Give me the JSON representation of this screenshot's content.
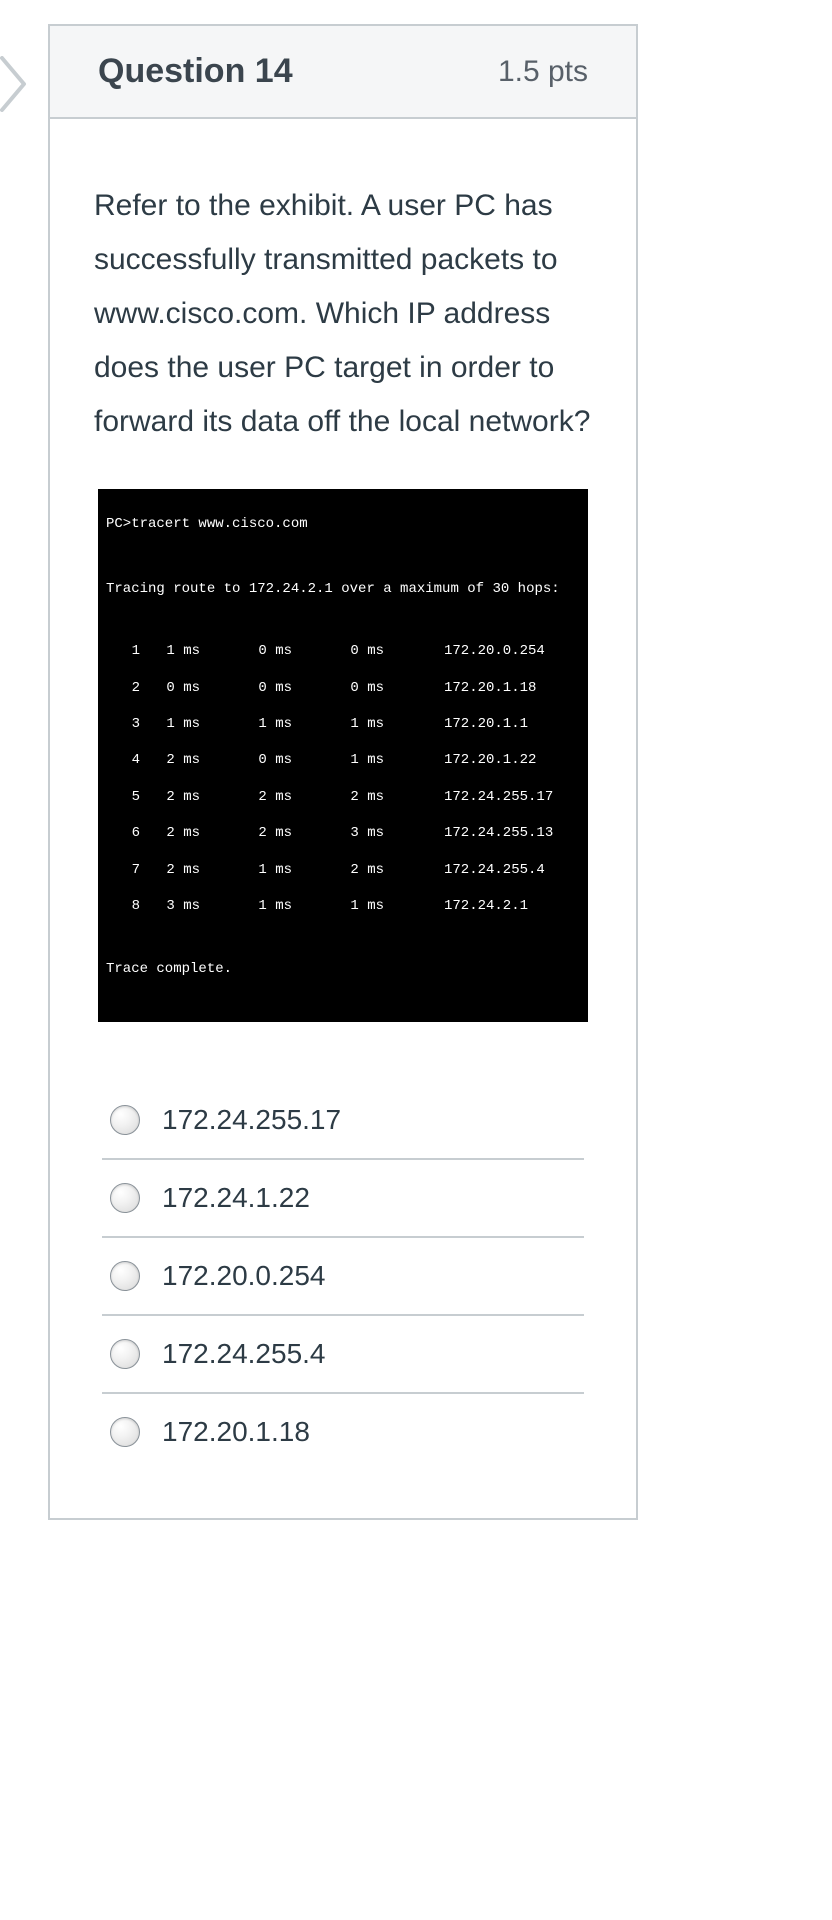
{
  "header": {
    "title": "Question 14",
    "points": "1.5 pts"
  },
  "question": "Refer to the exhibit. A user PC has successfully transmitted packets to www.cisco.com. Which IP address does the user PC target in order to forward its data off the local network?",
  "terminal": {
    "command": "PC>tracert www.cisco.com",
    "trace_header": "Tracing route to 172.24.2.1 over a maximum of 30 hops:",
    "hops": [
      {
        "n": "1",
        "t1": "1 ms",
        "t2": "0 ms",
        "t3": "0 ms",
        "ip": "172.20.0.254"
      },
      {
        "n": "2",
        "t1": "0 ms",
        "t2": "0 ms",
        "t3": "0 ms",
        "ip": "172.20.1.18"
      },
      {
        "n": "3",
        "t1": "1 ms",
        "t2": "1 ms",
        "t3": "1 ms",
        "ip": "172.20.1.1"
      },
      {
        "n": "4",
        "t1": "2 ms",
        "t2": "0 ms",
        "t3": "1 ms",
        "ip": "172.20.1.22"
      },
      {
        "n": "5",
        "t1": "2 ms",
        "t2": "2 ms",
        "t3": "2 ms",
        "ip": "172.24.255.17"
      },
      {
        "n": "6",
        "t1": "2 ms",
        "t2": "2 ms",
        "t3": "3 ms",
        "ip": "172.24.255.13"
      },
      {
        "n": "7",
        "t1": "2 ms",
        "t2": "1 ms",
        "t3": "2 ms",
        "ip": "172.24.255.4"
      },
      {
        "n": "8",
        "t1": "3 ms",
        "t2": "1 ms",
        "t3": "1 ms",
        "ip": "172.24.2.1"
      }
    ],
    "complete": "Trace complete."
  },
  "options": [
    "172.24.255.17",
    "172.24.1.22",
    "172.20.0.254",
    "172.24.255.4",
    "172.20.1.18"
  ]
}
